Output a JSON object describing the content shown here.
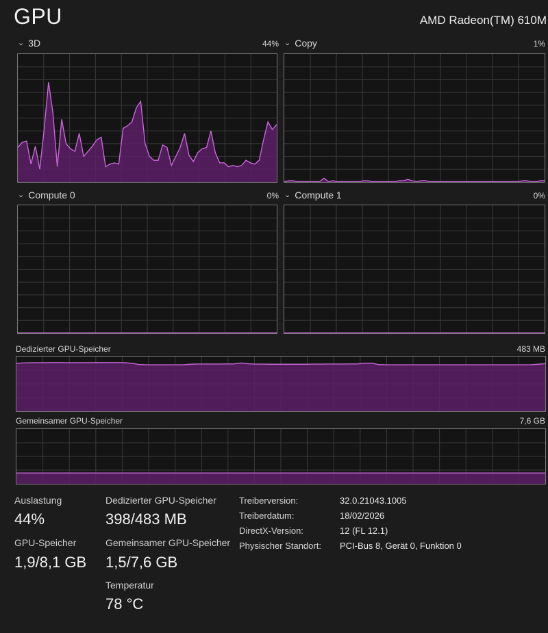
{
  "header": {
    "title": "GPU",
    "device": "AMD Radeon(TM) 610M"
  },
  "engines": [
    {
      "name": "3D",
      "percent": "44%"
    },
    {
      "name": "Copy",
      "percent": "1%"
    },
    {
      "name": "Compute 0",
      "percent": "0%"
    },
    {
      "name": "Compute 1",
      "percent": "0%"
    }
  ],
  "memory_graphs": {
    "dedicated": {
      "label": "Dedizierter GPU-Speicher",
      "max": "483 MB"
    },
    "shared": {
      "label": "Gemeinsamer GPU-Speicher",
      "max": "7,6 GB"
    }
  },
  "stats": {
    "utilization": {
      "label": "Auslastung",
      "value": "44%"
    },
    "gpu_memory": {
      "label": "GPU-Speicher",
      "value": "1,9/8,1 GB"
    },
    "dedicated_memory": {
      "label": "Dedizierter GPU-Speicher",
      "value": "398/483 MB"
    },
    "shared_memory": {
      "label": "Gemeinsamer GPU-Speicher",
      "value": "1,5/7,6 GB"
    },
    "temperature": {
      "label": "Temperatur",
      "value": "78 °C"
    }
  },
  "info": [
    {
      "key": "Treiberversion:",
      "value": "32.0.21043.1005"
    },
    {
      "key": "Treiberdatum:",
      "value": "18/02/2026"
    },
    {
      "key": "DirectX-Version:",
      "value": "12 (FL 12.1)"
    },
    {
      "key": "Physischer Standort:",
      "value": "PCI-Bus 8, Gerät 0, Funktion 0"
    }
  ],
  "colors": {
    "accent_line": "#c868d8",
    "accent_fill": "#5a1f66",
    "grid": "#3a3a3a",
    "background": "#1c1c1c"
  },
  "chart_data": [
    {
      "type": "area",
      "series": [
        {
          "values": [
            27,
            31,
            32,
            14,
            28,
            10,
            41,
            78,
            54,
            12,
            49,
            30,
            26,
            24,
            38,
            20,
            24,
            28,
            33,
            35,
            12,
            14,
            15,
            14,
            42,
            44,
            47,
            58,
            63,
            30,
            20,
            17,
            17,
            29,
            27,
            13,
            20,
            27,
            38,
            21,
            16,
            23,
            26,
            27,
            40,
            23,
            15,
            15,
            12,
            13,
            12,
            13,
            17,
            15,
            14,
            17,
            33,
            47,
            41,
            45
          ]
        }
      ],
      "ylim": [
        0,
        100
      ]
    },
    {
      "type": "area",
      "series": [
        {
          "values": [
            0,
            1,
            1,
            0,
            0,
            0,
            0,
            0,
            0,
            3,
            0,
            1,
            0,
            0,
            0,
            0,
            0,
            0,
            1,
            1,
            0,
            0,
            0,
            0,
            0,
            0,
            1,
            1,
            2,
            1,
            0,
            1,
            1,
            0,
            0,
            0,
            0,
            0,
            0,
            0,
            0,
            0,
            0,
            0,
            0,
            0,
            0,
            0,
            0,
            0,
            0,
            0,
            0,
            0,
            1,
            1,
            0,
            0,
            1,
            1
          ]
        }
      ],
      "ylim": [
        0,
        100
      ]
    },
    {
      "type": "area",
      "series": [
        {
          "values": [
            0,
            0,
            0,
            0,
            0,
            0,
            0,
            0,
            0,
            0,
            0,
            0,
            0,
            0,
            0,
            0,
            0,
            0,
            0,
            0,
            0,
            0,
            0,
            0,
            0,
            0,
            0,
            0,
            0,
            0,
            0,
            0,
            0,
            0,
            0,
            0,
            0,
            0,
            0,
            0,
            0,
            0,
            0,
            0,
            0,
            0,
            0,
            0,
            0,
            0,
            0,
            0,
            0,
            0,
            0,
            0,
            0,
            0,
            0,
            0
          ]
        }
      ],
      "ylim": [
        0,
        100
      ]
    },
    {
      "type": "area",
      "series": [
        {
          "values": [
            0,
            0,
            0,
            0,
            0,
            0,
            0,
            0,
            0,
            0,
            0,
            0,
            0,
            0,
            0,
            0,
            0,
            0,
            0,
            0,
            0,
            0,
            0,
            0,
            0,
            0,
            0,
            0,
            0,
            0,
            0,
            0,
            0,
            0,
            0,
            0,
            0,
            0,
            0,
            0,
            0,
            0,
            0,
            0,
            0,
            0,
            0,
            0,
            0,
            0,
            0,
            0,
            0,
            0,
            0,
            0,
            0,
            0,
            0,
            0
          ]
        }
      ],
      "ylim": [
        0,
        100
      ]
    },
    {
      "type": "area",
      "series": [
        {
          "values": [
            423,
            427,
            428,
            429,
            429,
            430,
            430,
            429,
            429,
            429,
            429,
            430,
            430,
            430,
            430,
            429,
            423,
            412,
            410,
            410,
            410,
            410,
            410,
            410,
            415,
            417,
            417,
            417,
            417,
            418,
            418,
            426,
            419,
            416,
            416,
            415,
            415,
            415,
            415,
            415,
            415,
            416,
            416,
            417,
            417,
            417,
            418,
            418,
            424,
            425,
            412,
            410,
            410,
            410,
            410,
            410,
            410,
            410,
            410,
            410,
            410,
            410,
            410,
            410,
            410,
            410,
            410,
            410,
            410,
            410,
            410,
            411,
            415,
            420
          ]
        }
      ],
      "ylim": [
        0,
        483
      ]
    },
    {
      "type": "area",
      "series": [
        {
          "values": [
            1.5,
            1.5,
            1.5,
            1.5,
            1.5,
            1.5,
            1.5,
            1.5,
            1.5,
            1.5,
            1.5,
            1.5,
            1.5,
            1.5,
            1.5,
            1.5,
            1.5,
            1.5,
            1.5,
            1.5
          ]
        }
      ],
      "ylim": [
        0,
        7.6
      ]
    }
  ]
}
